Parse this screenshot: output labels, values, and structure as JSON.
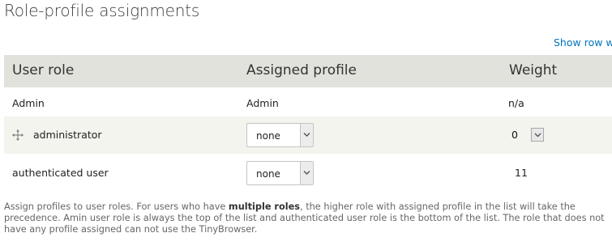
{
  "page": {
    "title": "Role-profile assignments",
    "show_weights_link": "Show row we"
  },
  "table": {
    "headers": {
      "user_role": "User role",
      "assigned_profile": "Assigned profile",
      "weight": "Weight"
    },
    "rows": [
      {
        "role": "Admin",
        "profile": "Admin",
        "weight": "n/a",
        "profile_is_select": false,
        "draggable": false
      },
      {
        "role": "administrator",
        "profile": "none",
        "weight": "0",
        "profile_is_select": true,
        "weight_is_select": true,
        "draggable": true
      },
      {
        "role": "authenticated user",
        "profile": "none",
        "weight": "11",
        "profile_is_select": true,
        "weight_is_select": false,
        "draggable": false
      }
    ]
  },
  "description": {
    "part1": "Assign profiles to user roles. For users who have ",
    "bold": "multiple roles",
    "part2": ", the higher role with assigned profile in the list will take the precedence. Amin user role is always the top of the list and authenticated user role is the bottom of the list. The role that does not have any profile assigned can not use the TinyBrowser."
  },
  "icons": {
    "drag_handle": "move-cross-icon",
    "select_arrow": "chevron-down-icon"
  },
  "colors": {
    "link": "#0074bd",
    "header_bg": "#e1e2dc",
    "stripe_bg": "#f3f4ee"
  }
}
